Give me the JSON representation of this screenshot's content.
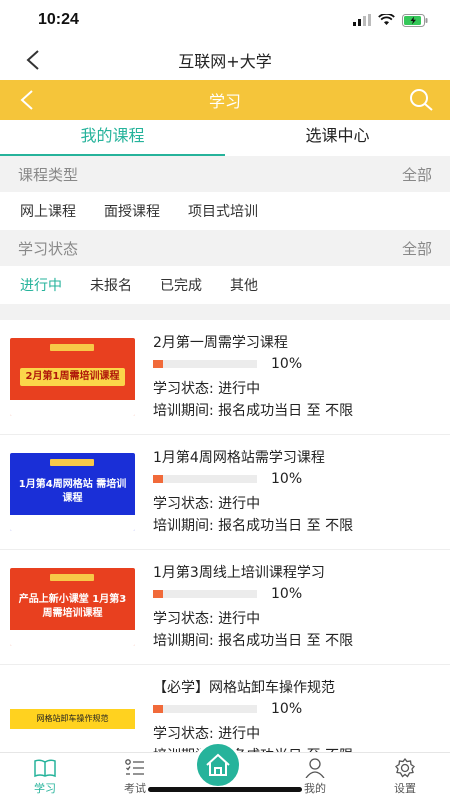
{
  "status": {
    "time": "10:24"
  },
  "header": {
    "title": "互联网+大学"
  },
  "topbar": {
    "title": "学习"
  },
  "tabs": [
    {
      "label": "我的课程",
      "active": true
    },
    {
      "label": "选课中心",
      "active": false
    }
  ],
  "course_type": {
    "label": "课程类型",
    "all": "全部",
    "options": [
      "网上课程",
      "面授课程",
      "项目式培训"
    ]
  },
  "study_status": {
    "label": "学习状态",
    "all": "全部",
    "options": [
      "进行中",
      "未报名",
      "已完成",
      "其他"
    ],
    "active": "进行中"
  },
  "courses": [
    {
      "title": "2月第一周需学习课程",
      "progress": "10%",
      "progress_value": 0.1,
      "status": "学习状态: 进行中",
      "period": "培训期间: 报名成功当日 至 不限",
      "thumb_style": "red",
      "thumb_text": "2月第1周需培训课程"
    },
    {
      "title": "1月第4周网格站需学习课程",
      "progress": "10%",
      "progress_value": 0.1,
      "status": "学习状态: 进行中",
      "period": "培训期间: 报名成功当日 至 不限",
      "thumb_style": "blue",
      "thumb_text": "1月第4周网格站 需培训课程"
    },
    {
      "title": "1月第3周线上培训课程学习",
      "progress": "10%",
      "progress_value": 0.1,
      "status": "学习状态: 进行中",
      "period": "培训期间: 报名成功当日 至 不限",
      "thumb_style": "red2",
      "thumb_text": "产品上新小课堂 1月第3周需培训课程"
    },
    {
      "title": "【必学】网格站卸车操作规范",
      "progress": "10%",
      "progress_value": 0.1,
      "status": "学习状态: 进行中",
      "period": "培训期间: 报名成功当日 至 不限",
      "thumb_style": "yellow",
      "thumb_text": "网格站卸车操作规范"
    }
  ],
  "nav": [
    {
      "label": "学习",
      "icon": "book-icon",
      "active": true
    },
    {
      "label": "考试",
      "icon": "list-icon",
      "active": false
    },
    {
      "label": "",
      "icon": "home-icon",
      "active": false
    },
    {
      "label": "我的",
      "icon": "user-icon",
      "active": false
    },
    {
      "label": "设置",
      "icon": "gear-icon",
      "active": false
    }
  ],
  "colors": {
    "accent": "#26b39b",
    "topbar": "#f5c53a",
    "progress": "#f16a3a"
  }
}
